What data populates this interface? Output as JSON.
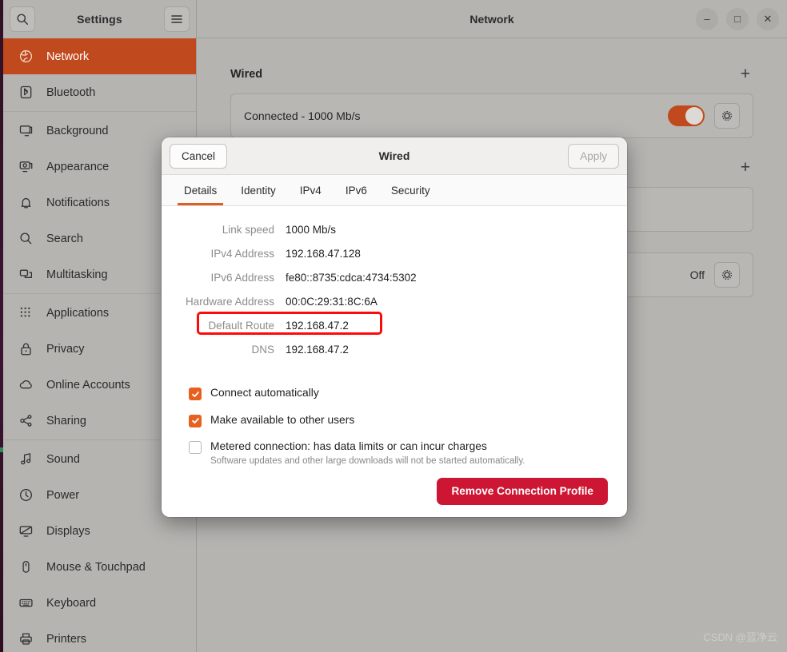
{
  "sidebar": {
    "title": "Settings",
    "search_icon": "search-icon",
    "menu_icon": "hamburger-menu-icon",
    "items": [
      {
        "label": "Network",
        "icon": "globe-icon",
        "active": true,
        "sep_after": false
      },
      {
        "label": "Bluetooth",
        "icon": "bluetooth-icon",
        "active": false,
        "sep_after": true
      },
      {
        "label": "Background",
        "icon": "desktop-icon",
        "active": false,
        "sep_after": false
      },
      {
        "label": "Appearance",
        "icon": "appearance-icon",
        "active": false,
        "sep_after": false
      },
      {
        "label": "Notifications",
        "icon": "bell-icon",
        "active": false,
        "sep_after": false
      },
      {
        "label": "Search",
        "icon": "search-icon",
        "active": false,
        "sep_after": false
      },
      {
        "label": "Multitasking",
        "icon": "windows-icon",
        "active": false,
        "sep_after": true
      },
      {
        "label": "Applications",
        "icon": "grid-icon",
        "active": false,
        "sep_after": false
      },
      {
        "label": "Privacy",
        "icon": "lock-icon",
        "active": false,
        "sep_after": false
      },
      {
        "label": "Online Accounts",
        "icon": "cloud-icon",
        "active": false,
        "sep_after": false
      },
      {
        "label": "Sharing",
        "icon": "share-icon",
        "active": false,
        "sep_after": true
      },
      {
        "label": "Sound",
        "icon": "music-note-icon",
        "active": false,
        "sep_after": false
      },
      {
        "label": "Power",
        "icon": "power-icon",
        "active": false,
        "sep_after": false
      },
      {
        "label": "Displays",
        "icon": "display-icon",
        "active": false,
        "sep_after": false
      },
      {
        "label": "Mouse & Touchpad",
        "icon": "mouse-icon",
        "active": false,
        "sep_after": false
      },
      {
        "label": "Keyboard",
        "icon": "keyboard-icon",
        "active": false,
        "sep_after": false
      },
      {
        "label": "Printers",
        "icon": "printer-icon",
        "active": false,
        "sep_after": false
      }
    ]
  },
  "window": {
    "title": "Network",
    "minimize_label": "–",
    "maximize_label": "□",
    "close_label": "✕"
  },
  "network_panel": {
    "wired_section_title": "Wired",
    "wired_add_label": "+",
    "wired_status": "Connected - 1000 Mb/s",
    "wired_toggle_on": true,
    "second_add_label": "+",
    "vpn_status": "Off"
  },
  "dialog": {
    "cancel_label": "Cancel",
    "title": "Wired",
    "apply_label": "Apply",
    "apply_disabled": true,
    "tabs": [
      {
        "label": "Details",
        "active": true
      },
      {
        "label": "Identity",
        "active": false
      },
      {
        "label": "IPv4",
        "active": false
      },
      {
        "label": "IPv6",
        "active": false
      },
      {
        "label": "Security",
        "active": false
      }
    ],
    "details": [
      {
        "key": "Link speed",
        "value": "1000 Mb/s"
      },
      {
        "key": "IPv4 Address",
        "value": "192.168.47.128"
      },
      {
        "key": "IPv6 Address",
        "value": "fe80::8735:cdca:4734:5302"
      },
      {
        "key": "Hardware Address",
        "value": "00:0C:29:31:8C:6A"
      },
      {
        "key": "Default Route",
        "value": "192.168.47.2"
      },
      {
        "key": "DNS",
        "value": "192.168.47.2"
      }
    ],
    "highlight_color": "#fb0b0b",
    "checkboxes": [
      {
        "label": "Connect automatically",
        "checked": true,
        "sub": ""
      },
      {
        "label": "Make available to other users",
        "checked": true,
        "sub": ""
      },
      {
        "label": "Metered connection: has data limits or can incur charges",
        "checked": false,
        "sub": "Software updates and other large downloads will not be started automatically."
      }
    ],
    "remove_button_label": "Remove Connection Profile",
    "remove_button_color": "#cc1633"
  },
  "watermark": "CSDN @蓝净云",
  "theme": {
    "accent": "#c0491d",
    "chrome_bg": "#b6b4b1",
    "tab_underline": "#e05d20"
  }
}
